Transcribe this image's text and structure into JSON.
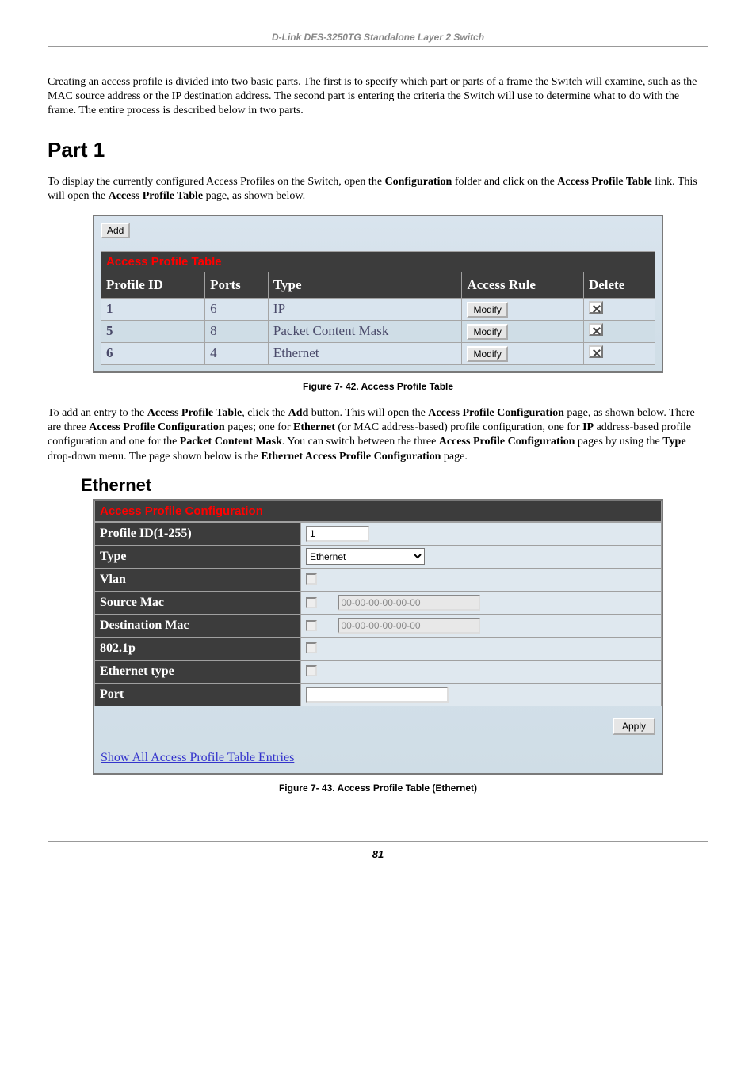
{
  "header": {
    "title": "D-Link DES-3250TG Standalone Layer 2 Switch"
  },
  "intro": "Creating an access profile is divided into two basic parts. The first is to specify which part or parts of a frame the Switch will examine, such as the MAC source address or the IP destination address. The second part is entering the criteria the Switch will use to determine what to do with the frame. The entire process is described below in two parts.",
  "part1": {
    "heading": "Part 1",
    "para_prefix": "To display the currently configured Access Profiles on the Switch, open the ",
    "para_bold1": "Configuration",
    "para_mid": " folder and click on the ",
    "para_bold2": "Access Profile Table",
    "para_suffix1": " link. This will open the ",
    "para_bold3": "Access Profile Table",
    "para_suffix2": " page, as shown below."
  },
  "figure1": {
    "add_label": "Add",
    "table_caption": "Access Profile Table",
    "columns": [
      "Profile ID",
      "Ports",
      "Type",
      "Access Rule",
      "Delete"
    ],
    "rows": [
      {
        "profile_id": "1",
        "ports": "6",
        "type": "IP",
        "access_rule": "Modify"
      },
      {
        "profile_id": "5",
        "ports": "8",
        "type": "Packet Content Mask",
        "access_rule": "Modify"
      },
      {
        "profile_id": "6",
        "ports": "4",
        "type": "Ethernet",
        "access_rule": "Modify"
      }
    ],
    "caption": "Figure 7- 42. Access Profile Table"
  },
  "between_text": {
    "t0": "To add an entry to the ",
    "b0": "Access Profile Table",
    "t1": ", click the ",
    "b1": "Add",
    "t2": " button. This will open the ",
    "b2": "Access Profile Configuration",
    "t3": " page, as shown below. There are three ",
    "b3": "Access Profile Configuration",
    "t4": " pages; one for ",
    "b4": "Ethernet",
    "t5": " (or MAC address-based) profile configuration, one for ",
    "b5": "IP",
    "t6": " address-based profile configuration and one for the ",
    "b6": "Packet Content Mask",
    "t7": ". You can switch between the three ",
    "b7": "Access Profile Configuration",
    "t8": " pages by using the ",
    "b8": "Type",
    "t9": " drop-down menu. The page shown below is the ",
    "b9": "Ethernet Access Profile Configuration",
    "t10": " page."
  },
  "ethernet_heading": "Ethernet",
  "figure2": {
    "table_caption": "Access Profile Configuration",
    "rows": {
      "profile_id_label": "Profile ID(1-255)",
      "profile_id_value": "1",
      "type_label": "Type",
      "type_value": "Ethernet",
      "vlan_label": "Vlan",
      "source_mac_label": "Source Mac",
      "source_mac_value": "00-00-00-00-00-00",
      "dest_mac_label": "Destination Mac",
      "dest_mac_value": "00-00-00-00-00-00",
      "p8021_label": "802.1p",
      "eth_type_label": "Ethernet type",
      "port_label": "Port",
      "port_value": ""
    },
    "apply_label": "Apply",
    "show_all": "Show All Access Profile Table Entries",
    "caption": "Figure 7- 43. Access Profile Table (Ethernet)"
  },
  "page_number": "81"
}
